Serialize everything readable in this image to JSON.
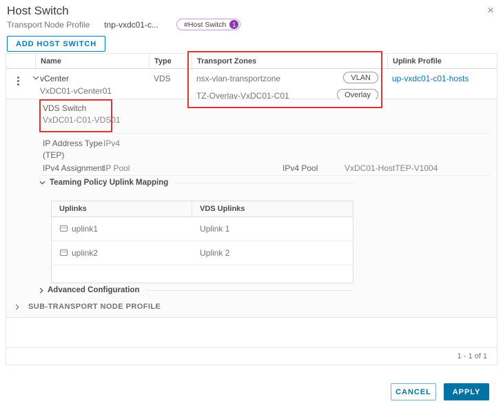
{
  "colors": {
    "accent_blue": "#0079b8",
    "primary_button_blue": "#0072a3",
    "badge_purple": "#8939ad",
    "highlight_red": "#d93535"
  },
  "header": {
    "title": "Host Switch",
    "profile_label": "Transport Node Profile",
    "profile_value": "tnp-vxdc01-c...",
    "badge_label": "#Host Switch",
    "badge_count": "1",
    "add_button": "ADD HOST SWITCH"
  },
  "grid": {
    "columns": {
      "name": "Name",
      "type": "Type",
      "transport_zones": "Transport Zones",
      "uplink_profile": "Uplink Profile"
    },
    "row": {
      "name": "vCenter",
      "subname": "VxDC01-vCenter01",
      "type": "VDS",
      "transport_zones": [
        {
          "name": "nsx-vlan-transportzone",
          "tag": "VLAN"
        },
        {
          "name": "TZ-Overlay-VxDC01-C01",
          "tag": "Overlay"
        }
      ],
      "uplink_profile": "up-vxdc01-c01-hosts"
    },
    "details": {
      "vds_switch_label": "VDS Switch",
      "vds_switch_value": "VxDC01-C01-VDS01",
      "ip_type_label_line1": "IP Address Type",
      "ip_type_label_line2": "(TEP)",
      "ip_type_value": "IPv4",
      "ipv4_assignment_label": "IPv4 Assignment",
      "ipv4_assignment_value": "IP Pool",
      "ipv4_pool_label": "IPv4 Pool",
      "ipv4_pool_value": "VxDC01-HostTEP-V1004",
      "teaming_section": "Teaming Policy Uplink Mapping",
      "teaming_table": {
        "col_uplinks": "Uplinks",
        "col_vds_uplinks": "VDS Uplinks",
        "rows": [
          {
            "uplink": "uplink1",
            "vds_uplink": "Uplink 1"
          },
          {
            "uplink": "uplink2",
            "vds_uplink": "Uplink 2"
          }
        ]
      },
      "advanced_section": "Advanced Configuration",
      "sub_tnp_section": "SUB-TRANSPORT NODE PROFILE"
    },
    "pagination": "1 - 1 of 1"
  },
  "footer": {
    "cancel": "CANCEL",
    "apply": "APPLY"
  }
}
